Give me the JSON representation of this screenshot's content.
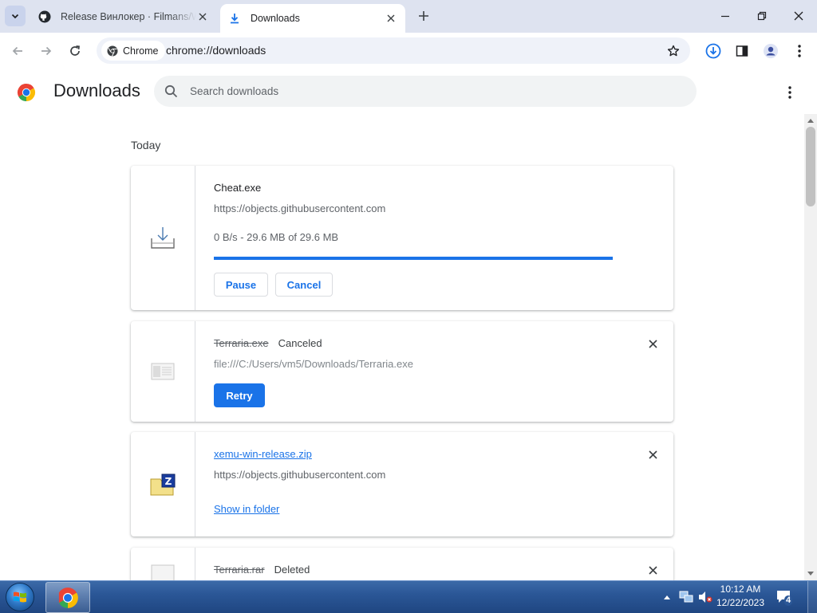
{
  "tabs": [
    {
      "title": "Release Винлокер · Filmans/Winlocker",
      "favicon": "github-icon",
      "active": false
    },
    {
      "title": "Downloads",
      "favicon": "download-icon",
      "active": true
    }
  ],
  "toolbar": {
    "chip_label": "Chrome",
    "url": "chrome://downloads"
  },
  "page": {
    "title": "Downloads",
    "search_placeholder": "Search downloads"
  },
  "downloads": {
    "day_label": "Today",
    "items": [
      {
        "filename": "Cheat.exe",
        "source": "https://objects.githubusercontent.com",
        "progress_text": "0 B/s - 29.6 MB of 29.6 MB",
        "progress_fraction": 1.0,
        "pause_label": "Pause",
        "cancel_label": "Cancel"
      },
      {
        "filename": "Terraria.exe",
        "status": "Canceled",
        "source": "file:///C:/Users/vm5/Downloads/Terraria.exe",
        "retry_label": "Retry"
      },
      {
        "filename": "xemu-win-release.zip",
        "source": "https://objects.githubusercontent.com",
        "show_label": "Show in folder"
      },
      {
        "filename": "Terraria.rar",
        "status": "Deleted"
      }
    ]
  },
  "taskbar": {
    "time": "10:12 AM",
    "date": "12/22/2023",
    "notification_count": "4"
  },
  "colors": {
    "accent": "#1a73e8",
    "tabstrip": "#dee3f0",
    "taskbar": "#2b5797"
  }
}
